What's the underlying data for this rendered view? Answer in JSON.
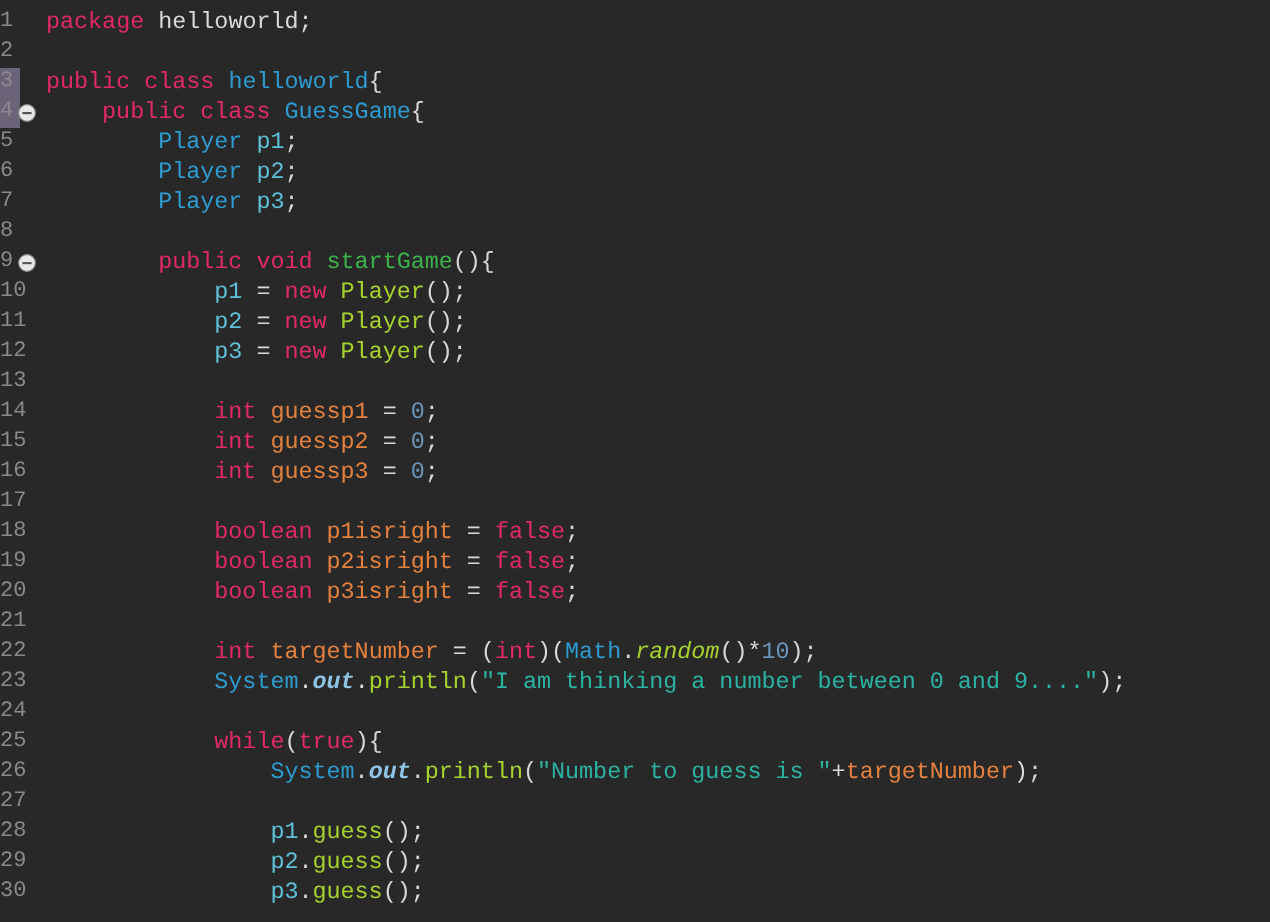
{
  "editor": {
    "lines": [
      {
        "number": "1",
        "tokens": [
          {
            "kind": "kw",
            "text": "package"
          },
          {
            "kind": "plain",
            "text": " helloworld;"
          }
        ]
      },
      {
        "number": "2"
      },
      {
        "number": "3",
        "changed": true,
        "tokens": [
          {
            "kind": "kw",
            "text": "public class "
          },
          {
            "kind": "type",
            "text": "helloworld"
          },
          {
            "kind": "plain",
            "text": "{"
          }
        ],
        "children": [
          {
            "number": "4",
            "changed": true,
            "fold": true,
            "tokens": [
              {
                "kind": "kw",
                "text": "public class "
              },
              {
                "kind": "type",
                "text": "GuessGame"
              },
              {
                "kind": "plain",
                "text": "{"
              }
            ],
            "children": [
              {
                "number": "5",
                "tokens": [
                  {
                    "kind": "type",
                    "text": "Player "
                  },
                  {
                    "kind": "field",
                    "text": "p1"
                  },
                  {
                    "kind": "plain",
                    "text": ";"
                  }
                ]
              },
              {
                "number": "6",
                "tokens": [
                  {
                    "kind": "type",
                    "text": "Player "
                  },
                  {
                    "kind": "field",
                    "text": "p2"
                  },
                  {
                    "kind": "plain",
                    "text": ";"
                  }
                ]
              },
              {
                "number": "7",
                "tokens": [
                  {
                    "kind": "type",
                    "text": "Player "
                  },
                  {
                    "kind": "field",
                    "text": "p3"
                  },
                  {
                    "kind": "plain",
                    "text": ";"
                  }
                ]
              },
              {
                "number": "8"
              },
              {
                "number": "9",
                "fold": true,
                "tokens": [
                  {
                    "kind": "kw",
                    "text": "public void "
                  },
                  {
                    "kind": "method",
                    "text": "startGame"
                  },
                  {
                    "kind": "plain",
                    "text": "(){"
                  }
                ],
                "children": [
                  {
                    "number": "10",
                    "tokens": [
                      {
                        "kind": "field",
                        "text": "p1"
                      },
                      {
                        "kind": "plain",
                        "text": " = "
                      },
                      {
                        "kind": "kw",
                        "text": "new "
                      },
                      {
                        "kind": "call",
                        "text": "Player"
                      },
                      {
                        "kind": "plain",
                        "text": "();"
                      }
                    ]
                  },
                  {
                    "number": "11",
                    "tokens": [
                      {
                        "kind": "field",
                        "text": "p2"
                      },
                      {
                        "kind": "plain",
                        "text": " = "
                      },
                      {
                        "kind": "kw",
                        "text": "new "
                      },
                      {
                        "kind": "call",
                        "text": "Player"
                      },
                      {
                        "kind": "plain",
                        "text": "();"
                      }
                    ]
                  },
                  {
                    "number": "12",
                    "tokens": [
                      {
                        "kind": "field",
                        "text": "p3"
                      },
                      {
                        "kind": "plain",
                        "text": " = "
                      },
                      {
                        "kind": "kw",
                        "text": "new "
                      },
                      {
                        "kind": "call",
                        "text": "Player"
                      },
                      {
                        "kind": "plain",
                        "text": "();"
                      }
                    ]
                  },
                  {
                    "number": "13"
                  },
                  {
                    "number": "14",
                    "tokens": [
                      {
                        "kind": "kw",
                        "text": "int "
                      },
                      {
                        "kind": "local",
                        "text": "guessp1"
                      },
                      {
                        "kind": "plain",
                        "text": " = "
                      },
                      {
                        "kind": "num",
                        "text": "0"
                      },
                      {
                        "kind": "plain",
                        "text": ";"
                      }
                    ]
                  },
                  {
                    "number": "15",
                    "tokens": [
                      {
                        "kind": "kw",
                        "text": "int "
                      },
                      {
                        "kind": "local",
                        "text": "guessp2"
                      },
                      {
                        "kind": "plain",
                        "text": " = "
                      },
                      {
                        "kind": "num",
                        "text": "0"
                      },
                      {
                        "kind": "plain",
                        "text": ";"
                      }
                    ]
                  },
                  {
                    "number": "16",
                    "tokens": [
                      {
                        "kind": "kw",
                        "text": "int "
                      },
                      {
                        "kind": "local",
                        "text": "guessp3"
                      },
                      {
                        "kind": "plain",
                        "text": " = "
                      },
                      {
                        "kind": "num",
                        "text": "0"
                      },
                      {
                        "kind": "plain",
                        "text": ";"
                      }
                    ]
                  },
                  {
                    "number": "17"
                  },
                  {
                    "number": "18",
                    "tokens": [
                      {
                        "kind": "kw",
                        "text": "boolean "
                      },
                      {
                        "kind": "local",
                        "text": "p1isright"
                      },
                      {
                        "kind": "plain",
                        "text": " = "
                      },
                      {
                        "kind": "kw",
                        "text": "false"
                      },
                      {
                        "kind": "plain",
                        "text": ";"
                      }
                    ]
                  },
                  {
                    "number": "19",
                    "tokens": [
                      {
                        "kind": "kw",
                        "text": "boolean "
                      },
                      {
                        "kind": "local",
                        "text": "p2isright"
                      },
                      {
                        "kind": "plain",
                        "text": " = "
                      },
                      {
                        "kind": "kw",
                        "text": "false"
                      },
                      {
                        "kind": "plain",
                        "text": ";"
                      }
                    ]
                  },
                  {
                    "number": "20",
                    "tokens": [
                      {
                        "kind": "kw",
                        "text": "boolean "
                      },
                      {
                        "kind": "local",
                        "text": "p3isright"
                      },
                      {
                        "kind": "plain",
                        "text": " = "
                      },
                      {
                        "kind": "kw",
                        "text": "false"
                      },
                      {
                        "kind": "plain",
                        "text": ";"
                      }
                    ]
                  },
                  {
                    "number": "21"
                  },
                  {
                    "number": "22",
                    "tokens": [
                      {
                        "kind": "kw",
                        "text": "int "
                      },
                      {
                        "kind": "local",
                        "text": "targetNumber"
                      },
                      {
                        "kind": "plain",
                        "text": " = ("
                      },
                      {
                        "kind": "kw",
                        "text": "int"
                      },
                      {
                        "kind": "plain",
                        "text": ")("
                      },
                      {
                        "kind": "type",
                        "text": "Math"
                      },
                      {
                        "kind": "plain",
                        "text": "."
                      },
                      {
                        "kind": "staticcall",
                        "text": "random"
                      },
                      {
                        "kind": "plain",
                        "text": "()*"
                      },
                      {
                        "kind": "num",
                        "text": "10"
                      },
                      {
                        "kind": "plain",
                        "text": ");"
                      }
                    ]
                  },
                  {
                    "number": "23",
                    "tokens": [
                      {
                        "kind": "type",
                        "text": "System"
                      },
                      {
                        "kind": "plain",
                        "text": "."
                      },
                      {
                        "kind": "static",
                        "text": "out"
                      },
                      {
                        "kind": "plain",
                        "text": "."
                      },
                      {
                        "kind": "call",
                        "text": "println"
                      },
                      {
                        "kind": "plain",
                        "text": "("
                      },
                      {
                        "kind": "str",
                        "text": "\"I am thinking a number between 0 and 9....\""
                      },
                      {
                        "kind": "plain",
                        "text": ");"
                      }
                    ]
                  },
                  {
                    "number": "24"
                  },
                  {
                    "number": "25",
                    "tokens": [
                      {
                        "kind": "kw",
                        "text": "while"
                      },
                      {
                        "kind": "plain",
                        "text": "("
                      },
                      {
                        "kind": "kw",
                        "text": "true"
                      },
                      {
                        "kind": "plain",
                        "text": "){"
                      }
                    ],
                    "children": [
                      {
                        "number": "26",
                        "tokens": [
                          {
                            "kind": "type",
                            "text": "System"
                          },
                          {
                            "kind": "plain",
                            "text": "."
                          },
                          {
                            "kind": "static",
                            "text": "out"
                          },
                          {
                            "kind": "plain",
                            "text": "."
                          },
                          {
                            "kind": "call",
                            "text": "println"
                          },
                          {
                            "kind": "plain",
                            "text": "("
                          },
                          {
                            "kind": "str",
                            "text": "\"Number to guess is \""
                          },
                          {
                            "kind": "plain",
                            "text": "+"
                          },
                          {
                            "kind": "local",
                            "text": "targetNumber"
                          },
                          {
                            "kind": "plain",
                            "text": ");"
                          }
                        ]
                      },
                      {
                        "number": "27"
                      },
                      {
                        "number": "28",
                        "tokens": [
                          {
                            "kind": "field",
                            "text": "p1"
                          },
                          {
                            "kind": "plain",
                            "text": "."
                          },
                          {
                            "kind": "call",
                            "text": "guess"
                          },
                          {
                            "kind": "plain",
                            "text": "();"
                          }
                        ]
                      },
                      {
                        "number": "29",
                        "tokens": [
                          {
                            "kind": "field",
                            "text": "p2"
                          },
                          {
                            "kind": "plain",
                            "text": "."
                          },
                          {
                            "kind": "call",
                            "text": "guess"
                          },
                          {
                            "kind": "plain",
                            "text": "();"
                          }
                        ]
                      },
                      {
                        "number": "30",
                        "tokens": [
                          {
                            "kind": "field",
                            "text": "p3"
                          },
                          {
                            "kind": "plain",
                            "text": "."
                          },
                          {
                            "kind": "call",
                            "text": "guess"
                          },
                          {
                            "kind": "plain",
                            "text": "();"
                          }
                        ]
                      }
                    ]
                  }
                ]
              }
            ]
          }
        ]
      }
    ]
  }
}
